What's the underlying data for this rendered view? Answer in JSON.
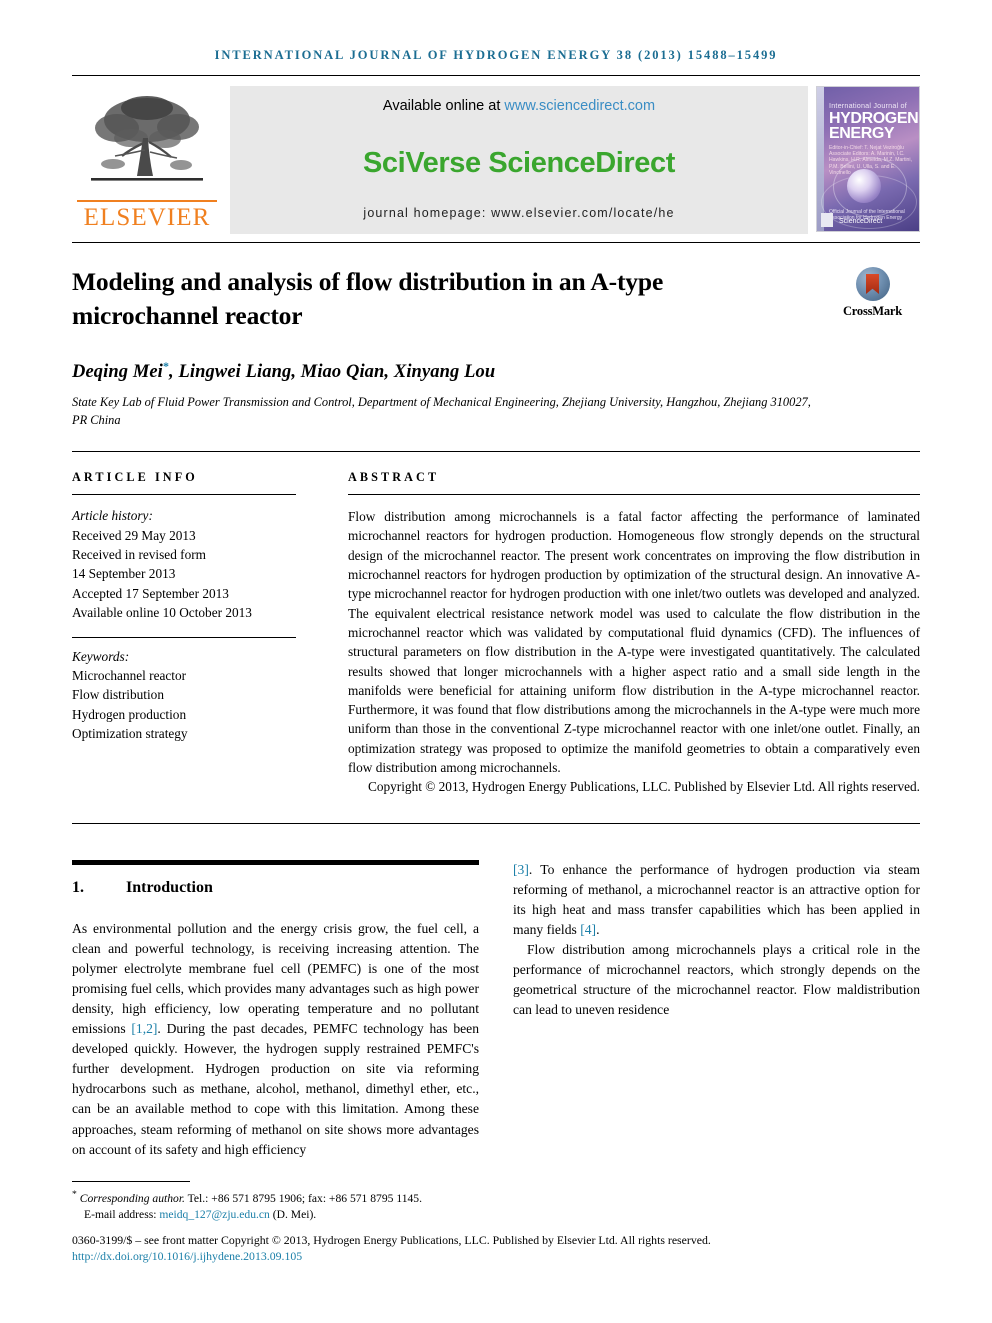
{
  "running_head": "International Journal of Hydrogen Energy 38 (2013) 15488–15499",
  "masthead": {
    "publisher_name": "ELSEVIER",
    "available_prefix": "Available online at ",
    "available_url": "www.sciencedirect.com",
    "sciverse_logo": "SciVerse ScienceDirect",
    "journal_homepage": "journal homepage: www.elsevier.com/locate/he",
    "cover": {
      "line1": "International Journal of",
      "line2": "HYDROGEN ENERGY",
      "editors": "Editor-in-Chief: T. Nejat Veziroğlu   Associate Editors: A. Marinin, I.C. Hawkins, H.R. Almeida, M.Z. Martini, P.M. Bellini, U. Ulla, S. and E. Vincinello",
      "footer": "Official Journal of the International Association for Hydrogen Energy",
      "sciencedirect": "ScienceDirect"
    }
  },
  "article": {
    "title": "Modeling and analysis of flow distribution in an A-type microchannel reactor",
    "crossmark_label": "CrossMark",
    "authors": "Deqing Mei",
    "authors_rest": ", Lingwei Liang, Miao Qian, Xinyang Lou",
    "corresponding_marker": "*",
    "affiliation": "State Key Lab of Fluid Power Transmission and Control, Department of Mechanical Engineering, Zhejiang University, Hangzhou, Zhejiang 310027, PR China"
  },
  "article_info": {
    "heading": "ARTICLE INFO",
    "history_label": "Article history:",
    "history": [
      "Received 29 May 2013",
      "Received in revised form",
      "14 September 2013",
      "Accepted 17 September 2013",
      "Available online 10 October 2013"
    ],
    "keywords_label": "Keywords:",
    "keywords": [
      "Microchannel reactor",
      "Flow distribution",
      "Hydrogen production",
      "Optimization strategy"
    ]
  },
  "abstract": {
    "heading": "ABSTRACT",
    "body": "Flow distribution among microchannels is a fatal factor affecting the performance of laminated microchannel reactors for hydrogen production. Homogeneous flow strongly depends on the structural design of the microchannel reactor. The present work concentrates on improving the flow distribution in microchannel reactors for hydrogen production by optimization of the structural design. An innovative A-type microchannel reactor for hydrogen production with one inlet/two outlets was developed and analyzed. The equivalent electrical resistance network model was used to calculate the flow distribution in the microchannel reactor which was validated by computational fluid dynamics (CFD). The influences of structural parameters on flow distribution in the A-type were investigated quantitatively. The calculated results showed that longer microchannels with a higher aspect ratio and a small side length in the manifolds were beneficial for attaining uniform flow distribution in the A-type microchannel reactor. Furthermore, it was found that flow distributions among the microchannels in the A-type were much more uniform than those in the conventional Z-type microchannel reactor with one inlet/one outlet. Finally, an optimization strategy was proposed to optimize the manifold geometries to obtain a comparatively even flow distribution among microchannels.",
    "copyright": "Copyright © 2013, Hydrogen Energy Publications, LLC. Published by Elsevier Ltd. All rights reserved."
  },
  "introduction": {
    "number": "1.",
    "title": "Introduction",
    "left_para_1_a": "As environmental pollution and the energy crisis grow, the fuel cell, a clean and powerful technology, is receiving increasing attention. The polymer electrolyte membrane fuel cell (PEMFC) is one of the most promising fuel cells, which provides many advantages such as high power density, high efficiency, low operating temperature and no pollutant emissions ",
    "cite_12": "[1,2]",
    "left_para_1_b": ". During the past decades, PEMFC technology has been developed quickly. However, the hydrogen supply restrained PEMFC's further development. Hydrogen production on site via reforming hydrocarbons such as methane, alcohol, methanol, dimethyl ether, etc., can be an available method to cope with this limitation. Among these approaches, steam reforming of methanol on site shows more advantages on account of its safety and high efficiency ",
    "cite_3": "[3]",
    "right_para_1_c": ". To enhance the performance of hydrogen production via steam reforming of methanol, a microchannel reactor is an attractive option for its high heat and mass transfer capabilities which has been applied in many fields ",
    "cite_4": "[4]",
    "right_para_1_d": ".",
    "right_para_2": "Flow distribution among microchannels plays a critical role in the performance of microchannel reactors, which strongly depends on the geometrical structure of the microchannel reactor. Flow maldistribution can lead to uneven residence"
  },
  "footnotes": {
    "corresponding_marker": "*",
    "corresponding_label": "Corresponding author.",
    "corresponding_tel": " Tel.: +86 571 8795 1906; fax: +86 571 8795 1145.",
    "email_label": "E-mail address: ",
    "email": "meidq_127@zju.edu.cn",
    "email_suffix": " (D. Mei).",
    "issn_line": "0360-3199/$ – see front matter Copyright © 2013, Hydrogen Energy Publications, LLC. Published by Elsevier Ltd. All rights reserved.",
    "doi": "http://dx.doi.org/10.1016/j.ijhydene.2013.09.105"
  },
  "colors": {
    "journal_blue": "#1b6d92",
    "link_blue": "#1b7fa8",
    "sd_green": "#3aa62e",
    "elsevier_orange": "#f08020",
    "sd_url_blue": "#3a8dc4"
  }
}
